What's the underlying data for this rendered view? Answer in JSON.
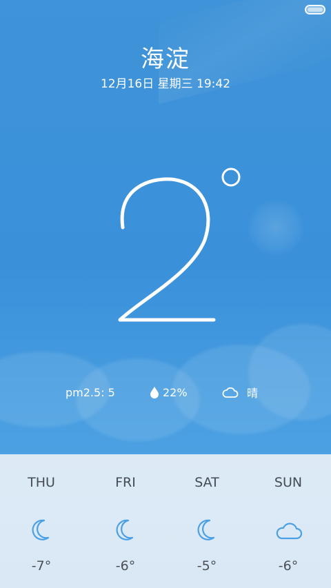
{
  "location": {
    "city": "海淀",
    "datetime": "12月16日 星期三 19:42"
  },
  "current": {
    "temperature": "2",
    "pm25": "pm2.5: 5",
    "humidity": "22%",
    "condition": "晴",
    "humidity_icon": "water-drop-icon",
    "condition_icon": "cloud-icon"
  },
  "forecast": [
    {
      "day": "THU",
      "icon": "moon-icon",
      "temp": "-7°"
    },
    {
      "day": "FRI",
      "icon": "moon-icon",
      "temp": "-6°"
    },
    {
      "day": "SAT",
      "icon": "moon-icon",
      "temp": "-5°"
    },
    {
      "day": "SUN",
      "icon": "cloud-icon",
      "temp": "-6°"
    }
  ],
  "colors": {
    "sky": "#3a91da",
    "forecast_bg": "#dce9f5",
    "icon_blue": "#4aa0e4",
    "text_white": "#ffffff",
    "text_dark": "#444b52"
  }
}
